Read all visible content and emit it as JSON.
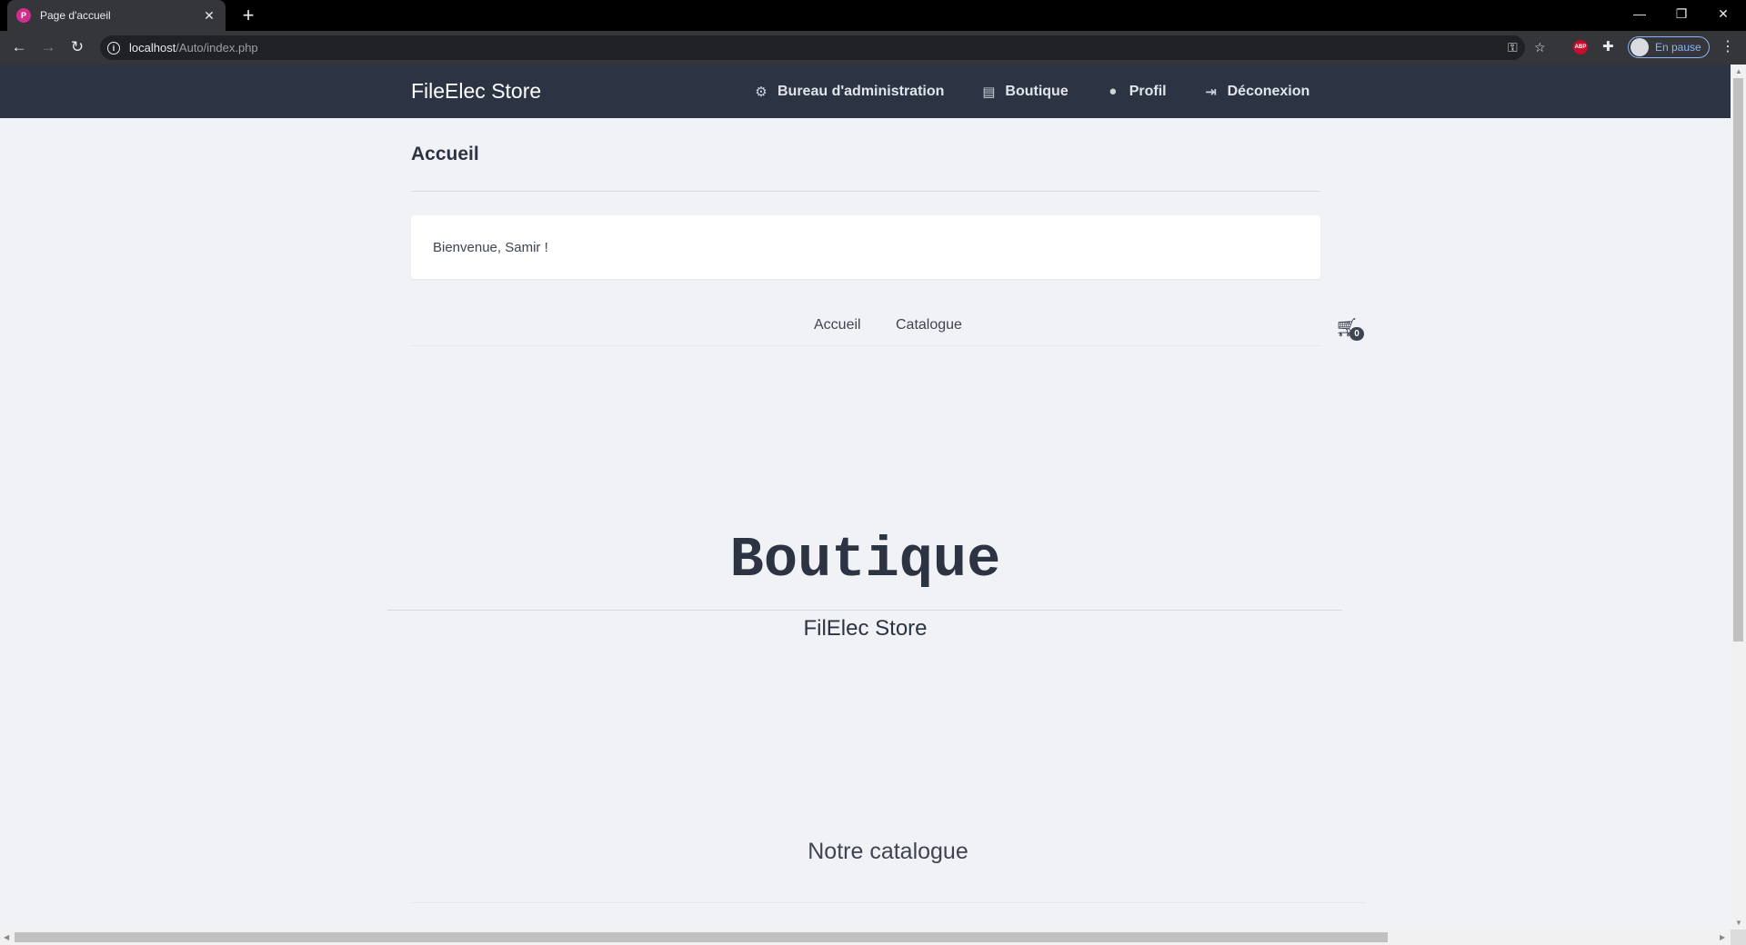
{
  "browser": {
    "tab_title": "Page d'accueil",
    "tab_favicon_letter": "P",
    "url_host": "localhost",
    "url_path": "/Auto/index.php",
    "profile_label": "En pause",
    "extension_abp_label": "ABP"
  },
  "site": {
    "brand": "FileElec Store",
    "nav": [
      {
        "label": "Bureau d'administration",
        "icon": "users-cog-icon"
      },
      {
        "label": "Boutique",
        "icon": "store-icon"
      },
      {
        "label": "Profil",
        "icon": "user-circle-icon"
      },
      {
        "label": "Déconexion",
        "icon": "sign-out-icon"
      }
    ],
    "page_heading": "Accueil",
    "welcome_message": "Bienvenue, Samir !",
    "subnav": [
      {
        "label": "Accueil"
      },
      {
        "label": "Catalogue"
      }
    ],
    "cart_count": "0",
    "hero_title": "Boutique",
    "hero_subtitle": "FilElec Store",
    "catalogue_title": "Notre catalogue"
  }
}
